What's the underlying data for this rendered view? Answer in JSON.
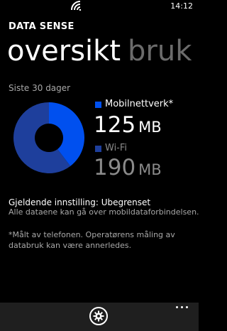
{
  "status_bar": {
    "time": "14:12",
    "signal_icon": "wifi-icon"
  },
  "app": {
    "title": "DATA SENSE"
  },
  "pivot": {
    "active": "oversikt",
    "inactive": "bruk"
  },
  "usage": {
    "period": "Siste 30 dager",
    "mobile": {
      "label": "Mobilnettverk*",
      "value": "125",
      "unit": "MB",
      "color": "#0050ef"
    },
    "wifi": {
      "label": "Wi-Fi",
      "value": "190",
      "unit": "MB",
      "color": "#1e3f9c"
    }
  },
  "chart_data": {
    "type": "pie",
    "slices": [
      {
        "label": "Mobilnettverk*",
        "value": 125,
        "color": "#0050ef"
      },
      {
        "label": "Wi-Fi",
        "value": 190,
        "color": "#1e3f9c"
      }
    ]
  },
  "setting": {
    "title": "Gjeldende innstilling: Ubegrenset",
    "description": "Alle dataene kan gå over mobildataforbindelsen."
  },
  "footnote": "*Målt av telefonen. Operatørens måling av databruk kan være annerledes.",
  "app_bar": {
    "settings_icon": "gear-icon",
    "more_icon": "ellipsis-icon"
  }
}
